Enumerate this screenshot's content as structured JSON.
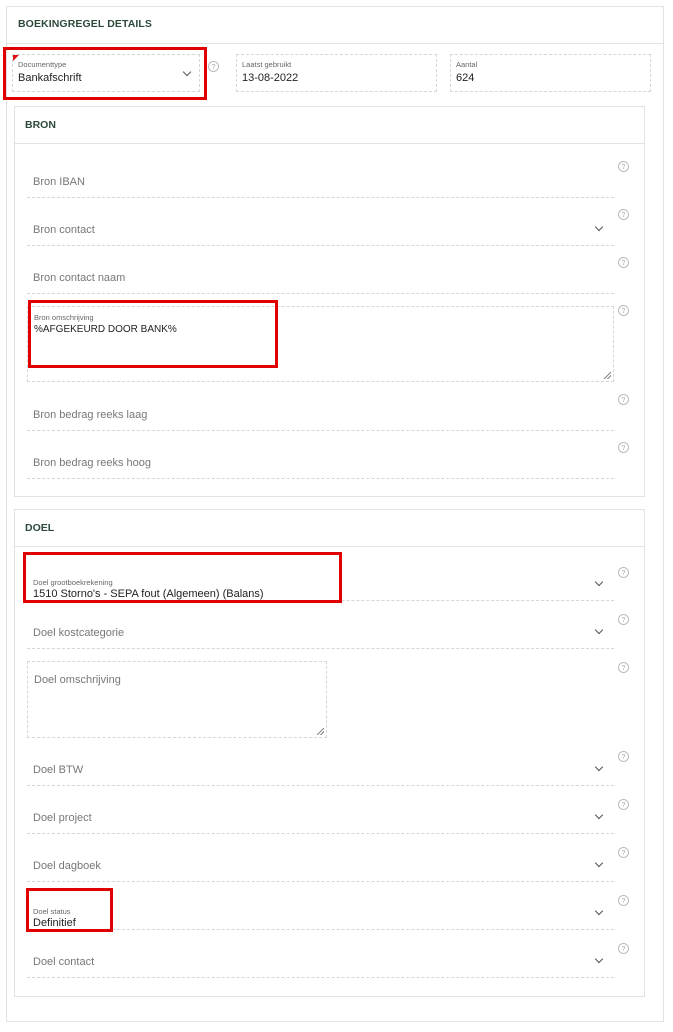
{
  "header": {
    "title": "BOEKINGREGEL DETAILS"
  },
  "top_fields": {
    "documenttype": {
      "label": "Documenttype",
      "value": "Bankafschrift"
    },
    "laatst_gebruikt": {
      "label": "Laatst gebruikt",
      "value": "13-08-2022"
    },
    "aantal": {
      "label": "Aantal",
      "value": "624"
    }
  },
  "bron": {
    "title": "BRON",
    "iban": {
      "placeholder": "Bron IBAN"
    },
    "contact": {
      "placeholder": "Bron contact"
    },
    "contact_naam": {
      "placeholder": "Bron contact naam"
    },
    "omschrijving": {
      "label": "Bron omschrijving",
      "value": "%AFGEKEURD DOOR BANK%"
    },
    "bedrag_laag": {
      "placeholder": "Bron bedrag reeks laag"
    },
    "bedrag_hoog": {
      "placeholder": "Bron bedrag reeks hoog"
    }
  },
  "doel": {
    "title": "DOEL",
    "grootboekrekening": {
      "label": "Doel grootboekrekening",
      "value": "1510 Storno's - SEPA fout (Algemeen) (Balans)"
    },
    "kostcategorie": {
      "placeholder": "Doel kostcategorie"
    },
    "omschrijving": {
      "placeholder": "Doel omschrijving"
    },
    "btw": {
      "placeholder": "Doel BTW"
    },
    "project": {
      "placeholder": "Doel project"
    },
    "dagboek": {
      "placeholder": "Doel dagboek"
    },
    "status": {
      "label": "Doel status",
      "value": "Definitief"
    },
    "contact": {
      "placeholder": "Doel contact"
    }
  },
  "help_icon_glyph": "?",
  "colors": {
    "highlight": "#e00000",
    "section_title": "#2d4a3a",
    "required_marker": "#dd1111"
  }
}
